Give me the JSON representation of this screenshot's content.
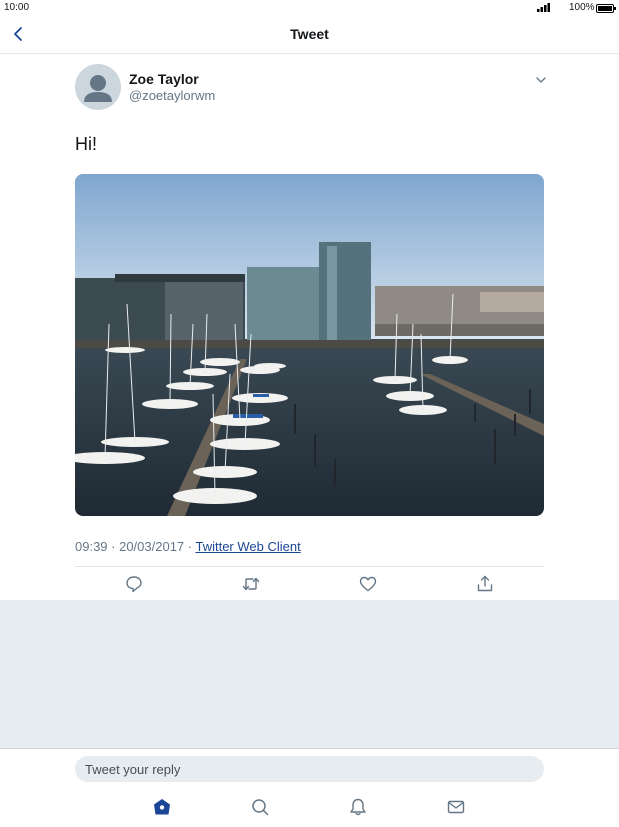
{
  "status": {
    "time": "10:00",
    "battery": "100%"
  },
  "nav": {
    "title": "Tweet"
  },
  "tweet": {
    "author_name": "Zoe Taylor",
    "author_handle": "@zoetaylorwm",
    "text": "Hi!",
    "timestamp": "09:39 · 20/03/2017 · ",
    "source": "Twitter Web Client"
  },
  "reply": {
    "placeholder": "Tweet your reply"
  },
  "icons": {
    "back": "chevron-left-icon",
    "more": "chevron-down-icon",
    "reply": "reply-icon",
    "retweet": "retweet-icon",
    "like": "heart-icon",
    "share": "share-icon",
    "home": "home-icon",
    "search": "search-icon",
    "notifications": "bell-icon",
    "messages": "mail-icon"
  },
  "colors": {
    "accent": "#1da1f2",
    "tab_active": "#1b4597",
    "icon": "#657786"
  }
}
